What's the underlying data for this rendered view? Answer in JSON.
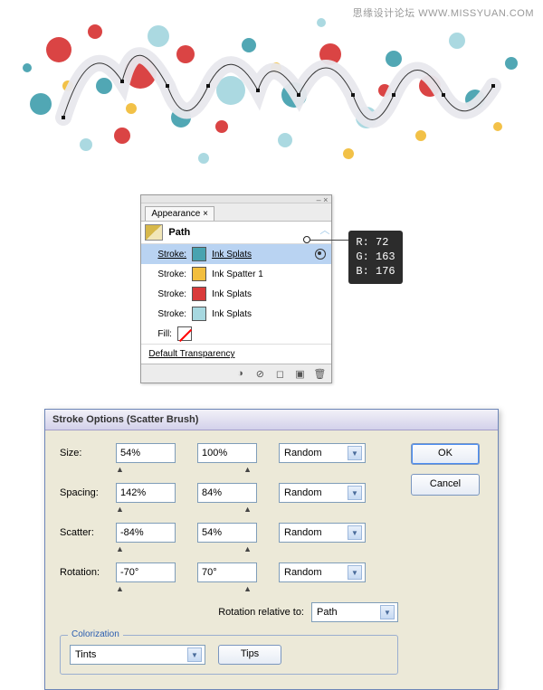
{
  "watermark": "思缘设计论坛  WWW.MISSYUAN.COM",
  "appearance": {
    "tab": "Appearance",
    "path_label": "Path",
    "stroke_label": "Stroke:",
    "fill_label": "Fill:",
    "strokes": [
      {
        "name": "Ink Splats",
        "color": "#48A3B0",
        "selected": true
      },
      {
        "name": "Ink Spatter 1",
        "color": "#F2BE3E",
        "selected": false
      },
      {
        "name": "Ink Splats",
        "color": "#D93A3A",
        "selected": false
      },
      {
        "name": "Ink Splats",
        "color": "#A7D8E0",
        "selected": false
      }
    ],
    "default_trans": "Default Transparency"
  },
  "rgb": {
    "R": "R:  72",
    "G": "G: 163",
    "B": "B: 176"
  },
  "dialog": {
    "title": "Stroke Options (Scatter Brush)",
    "labels": {
      "size": "Size:",
      "spacing": "Spacing:",
      "scatter": "Scatter:",
      "rotation": "Rotation:",
      "rotation_rel": "Rotation relative to:",
      "colorization": "Colorization"
    },
    "size": {
      "v1": "54%",
      "v2": "100%",
      "mode": "Random"
    },
    "spacing": {
      "v1": "142%",
      "v2": "84%",
      "mode": "Random"
    },
    "scatter": {
      "v1": "-84%",
      "v2": "54%",
      "mode": "Random"
    },
    "rotation": {
      "v1": "-70°",
      "v2": "70°",
      "mode": "Random"
    },
    "rot_rel": "Path",
    "colorization_method": "Tints",
    "buttons": {
      "ok": "OK",
      "cancel": "Cancel",
      "tips": "Tips"
    }
  }
}
